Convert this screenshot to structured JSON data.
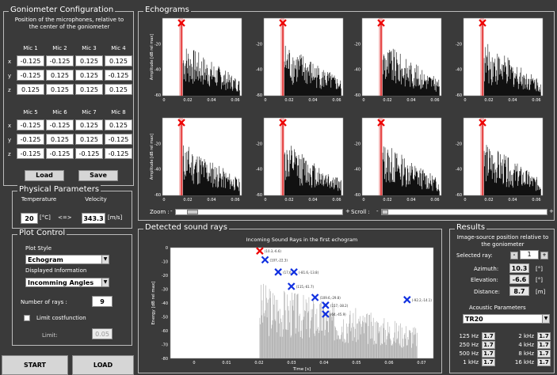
{
  "goniometer": {
    "title": "Goniometer Configuration",
    "description": "Position of the microphones, relative to the center of the goniometer",
    "headers_top": [
      "Mic 1",
      "Mic 2",
      "Mic 3",
      "Mic 4"
    ],
    "headers_bottom": [
      "Mic 5",
      "Mic 6",
      "Mic 7",
      "Mic 8"
    ],
    "row_labels": [
      "x",
      "y",
      "z"
    ],
    "top_values": [
      [
        "-0.125",
        "-0.125",
        "0.125",
        "0.125"
      ],
      [
        "-0.125",
        "0.125",
        "0.125",
        "-0.125"
      ],
      [
        "0.125",
        "0.125",
        "0.125",
        "0.125"
      ]
    ],
    "bottom_values": [
      [
        "-0.125",
        "-0.125",
        "0.125",
        "0.125"
      ],
      [
        "-0.125",
        "0.125",
        "0.125",
        "-0.125"
      ],
      [
        "-0.125",
        "-0.125",
        "-0.125",
        "-0.125"
      ]
    ],
    "load_label": "Load",
    "save_label": "Save"
  },
  "physical": {
    "title": "Physical Parameters",
    "temperature_label": "Temperature",
    "velocity_label": "Velocity",
    "temperature_value": "20",
    "temperature_unit": "[°C]",
    "arrow": "<=>",
    "velocity_value": "343.3",
    "velocity_unit": "[m/s]"
  },
  "plot_control": {
    "title": "Plot Control",
    "plot_style_label": "Plot Style",
    "plot_style_value": "Echogram",
    "displayed_info_label": "Displayed Information",
    "displayed_info_value": "Incomming Angles",
    "num_rays_label": "Number of rays :",
    "num_rays_value": "9",
    "limit_label": "Limit costfunction",
    "limit_field_label": "Limit:",
    "limit_value": "0.05"
  },
  "bottom_buttons": {
    "start": "START",
    "load": "LOAD"
  },
  "echograms": {
    "title": "Echograms",
    "ylabel": "Amplitude [dB rel max]",
    "ticks_y": [
      "-20",
      "-40",
      "-60"
    ],
    "ticks_x": [
      "0",
      "0.02",
      "0.04",
      "0.06"
    ],
    "zoom_label": "Zoom :",
    "scroll_label": "Scroll :",
    "minus": "-",
    "plus": "+"
  },
  "detected": {
    "title": "Detected sound rays",
    "plot_title": "Incoming Sound Rays in the first echogram",
    "xlabel": "Time [s]",
    "ylabel": "Energy [dB rel max]",
    "ticks_x": [
      "0",
      "0.01",
      "0.02",
      "0.03",
      "0.04",
      "0.05",
      "0.06",
      "0.07"
    ],
    "ticks_y": [
      "0",
      "-10",
      "-20",
      "-30",
      "-40",
      "-50",
      "-60",
      "-70",
      "-80"
    ],
    "marker_labels": [
      "(10.3,-6.6)",
      "(107,-22.3)",
      "(17,6.3)",
      "(-81.6,-13.8)",
      "(115,-61.7)",
      "(109.6,-29.8)",
      "(157,-38.2)",
      "(64,-45.9)",
      "(-92.2,-14.1)"
    ]
  },
  "results": {
    "title": "Results",
    "description": "Image-source position relative to the goniometer",
    "selected_ray_label": "Selected ray:",
    "selected_ray_value": "1",
    "azimuth_label": "Azimuth:",
    "azimuth_value": "10.3",
    "azimuth_unit": "[°]",
    "elevation_label": "Elevation:",
    "elevation_value": "-6.6",
    "elevation_unit": "[°]",
    "distance_label": "Distance:",
    "distance_value": "8.7",
    "distance_unit": "[m]",
    "acoustic_label": "Acoustic Parameters",
    "acoustic_value": "TR20",
    "bands": [
      {
        "label": "125 Hz",
        "value": "1.7"
      },
      {
        "label": "2 kHz",
        "value": "1.7"
      },
      {
        "label": "250 Hz",
        "value": "1.7"
      },
      {
        "label": "4 kHz",
        "value": "1.7"
      },
      {
        "label": "500 Hz",
        "value": "1.7"
      },
      {
        "label": "8 kHz",
        "value": "1.7"
      },
      {
        "label": "1 kHz",
        "value": "1.7"
      },
      {
        "label": "16 kHz",
        "value": "1.7"
      }
    ]
  }
}
